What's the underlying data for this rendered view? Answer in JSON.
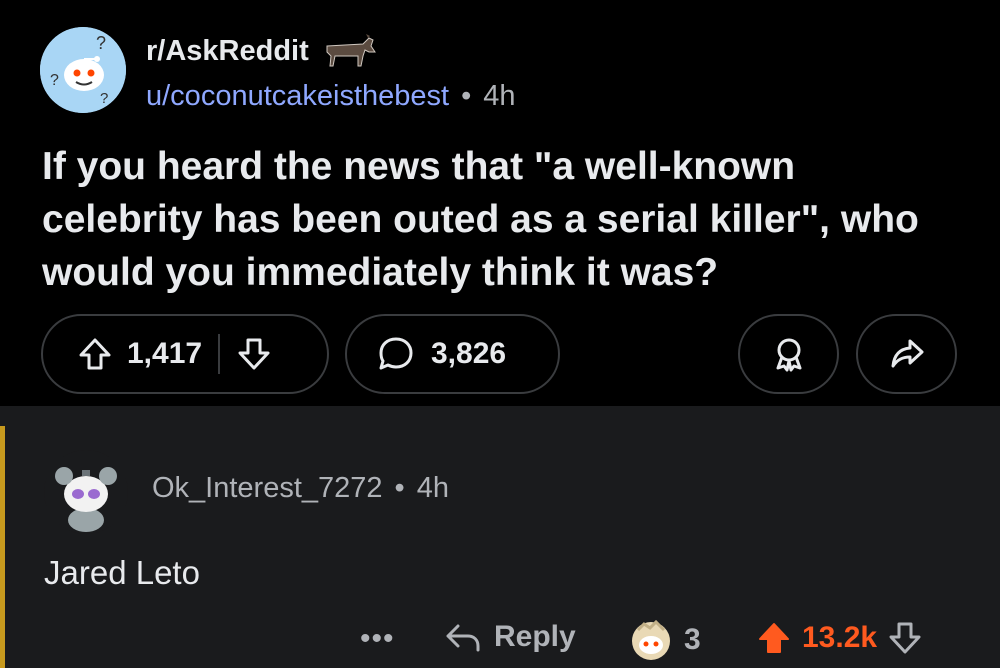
{
  "post": {
    "subreddit": "r/AskReddit",
    "author": "u/coconutcakeisthebest",
    "separator": "•",
    "age": "4h",
    "title": "If you heard the news that \"a well-known celebrity has been outed as a serial killer\", who would you immediately think it was?",
    "upvotes": "1,417",
    "comments": "3,826",
    "icons": [
      "subreddit-avatar-icon",
      "donkey-flair-icon",
      "upvote-icon",
      "downvote-icon",
      "comment-icon",
      "award-icon",
      "share-icon"
    ]
  },
  "comment": {
    "author": "Ok_Interest_7272",
    "separator": "•",
    "age": "4h",
    "body": "Jared Leto",
    "more": "•••",
    "reply_label": "Reply",
    "award_count": "3",
    "score": "13.2k"
  },
  "colors": {
    "background": "#000000",
    "comment_bg": "#1a1b1d",
    "username": "#8fa8ff",
    "upvoted": "#ff5a1f",
    "thread_bar": "#c79a1e"
  }
}
